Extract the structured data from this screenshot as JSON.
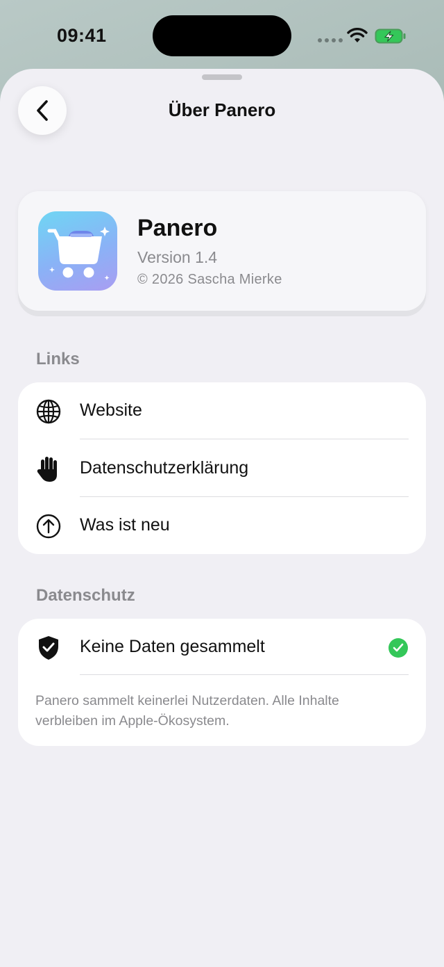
{
  "status_bar": {
    "time": "09:41"
  },
  "nav": {
    "title": "Über Panero",
    "back_icon": "chevron-left-icon"
  },
  "app_info": {
    "name": "Panero",
    "version": "Version 1.4",
    "copyright": "© 2026 Sascha Mierke",
    "icon": "shopping-cart-icon"
  },
  "links_section": {
    "header": "Links",
    "items": [
      {
        "label": "Website",
        "icon": "globe-icon"
      },
      {
        "label": "Datenschutzerklärung",
        "icon": "hand-raised-icon"
      },
      {
        "label": "Was ist neu",
        "icon": "arrow-up-circle-icon"
      }
    ]
  },
  "privacy_section": {
    "header": "Datenschutz",
    "item_label": "Keine Daten gesammelt",
    "item_icon": "shield-check-icon",
    "status_icon": "checkmark-circle-icon",
    "note": "Panero sammelt keinerlei Nutzerdaten. Alle Inhalte verbleiben im Apple-Ökosystem."
  },
  "colors": {
    "accent_green": "#34c759",
    "secondary_text": "#8a8a8e",
    "sheet_background": "#f0eff4"
  }
}
